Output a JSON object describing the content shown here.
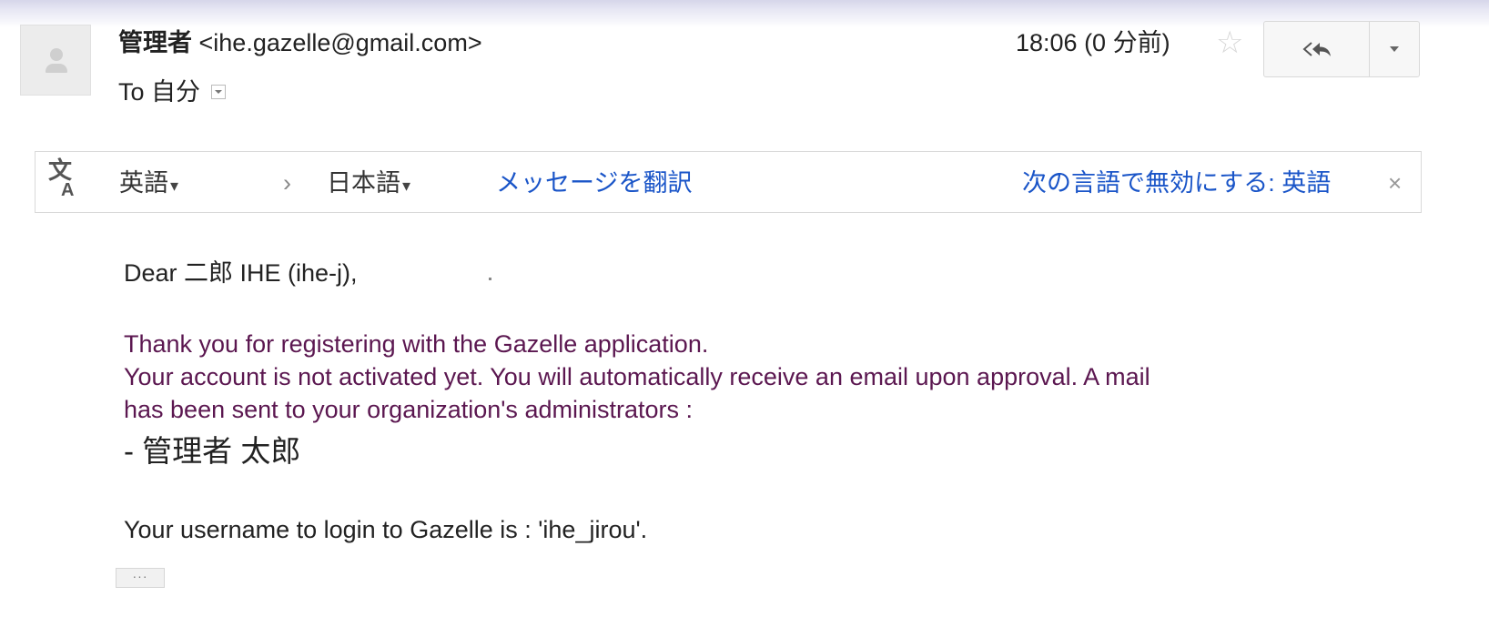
{
  "header": {
    "sender_name": "管理者",
    "sender_email": "<ihe.gazelle@gmail.com>",
    "to_label": "To",
    "recipient": "自分",
    "time": "18:06 (0 分前)",
    "star_icon": "star-outline-icon",
    "reply_icon": "reply-icon",
    "more_icon": "chevron-down-icon"
  },
  "translate_bar": {
    "icon": "translate-icon",
    "icon_glyph_main": "文",
    "icon_glyph_sub": "A",
    "source_language": "英語",
    "arrow": "›",
    "target_language": "日本語",
    "caret": "▾",
    "translate_link": "メッセージを翻訳",
    "disable_link": "次の言語で無効にする: 英語",
    "close": "×"
  },
  "body": {
    "greeting": "Dear 二郎 IHE (ihe-j),",
    "line1": "Thank you for registering with the Gazelle application.",
    "line2": "Your account is not activated yet. You will automatically receive an email upon approval. A mail",
    "line3": "has been sent to your organization's administrators :",
    "admin": "- 管理者 太郎",
    "username_line": "Your username to login to Gazelle is : 'ihe_jirou'.",
    "ellipsis": "···"
  },
  "colors": {
    "link": "#1a55c8",
    "quoted_text": "#5b1750"
  }
}
